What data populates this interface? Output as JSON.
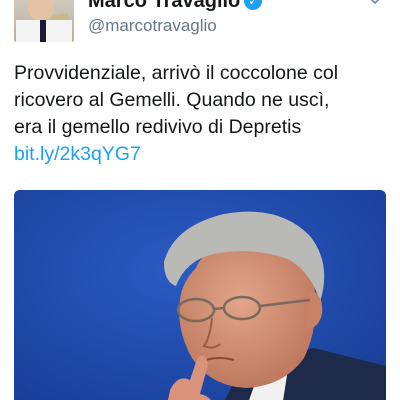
{
  "tweet": {
    "author_name": "Marco Travaglio",
    "author_handle": "@marcotravaglio",
    "verified_glyph": "✓",
    "text_lines": [
      "Provvidenziale, arrivò il coccolone col",
      "ricovero al Gemelli. Quando ne uscì,",
      "era il gemello redivivo di Depretis"
    ],
    "link_text": "bit.ly/2k3qYG7"
  },
  "icons": {
    "verified": "verified-badge-icon",
    "menu": "chevron-down-icon"
  },
  "colors": {
    "link": "#1da1f2",
    "verified": "#1da1f2",
    "text": "#14171a",
    "secondary": "#657786",
    "photo_background": "#1f49a8"
  }
}
